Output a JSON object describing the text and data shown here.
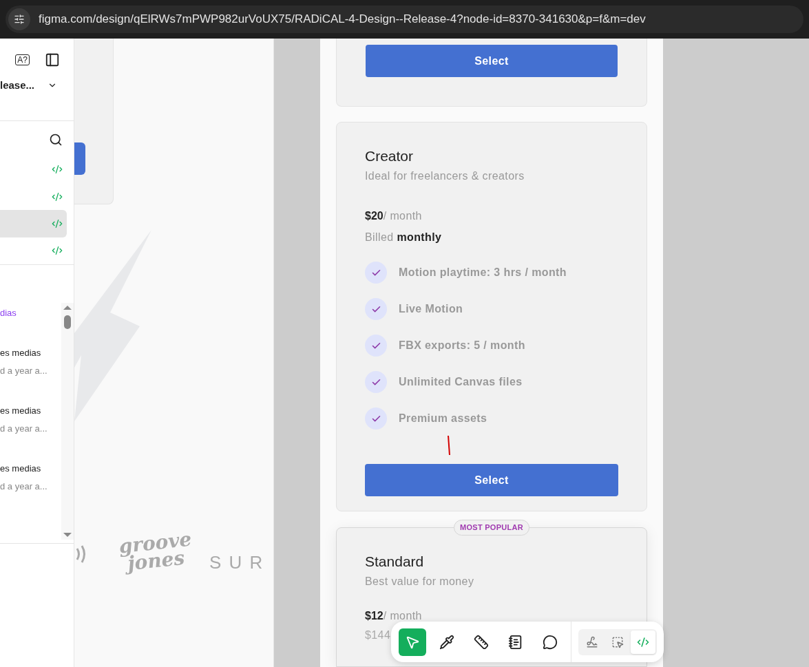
{
  "address_bar": {
    "url": "figma.com/design/qElRWs7mPWP982urVoUX75/RADiCAL-4-Design--Release-4?node-id=8370-341630&p=f&m=dev"
  },
  "sidebar": {
    "header_badge": "A?",
    "file_name": "lease...",
    "layers": [
      {
        "selected": false
      },
      {
        "selected": false
      },
      {
        "selected": true
      },
      {
        "selected": false
      }
    ],
    "comments_heading": "dias",
    "comments": [
      {
        "title": "es medias",
        "meta": "d a year a..."
      },
      {
        "title": "es medias",
        "meta": "d a year a..."
      },
      {
        "title": "es medias",
        "meta": "d a year a..."
      }
    ]
  },
  "canvas": {
    "logos": [
      "groove",
      "jones",
      "S U R"
    ]
  },
  "plans": [
    {
      "button": "Select"
    },
    {
      "name": "Creator",
      "subtitle": "Ideal for freelancers & creators",
      "price": "$20",
      "period": "/ month",
      "billing": "Billed **monthly**",
      "features": [
        "Motion playtime: 3 hrs / month",
        "Live Motion",
        "FBX exports: 5 / month",
        "Unlimited Canvas files",
        "Premium assets"
      ],
      "button": "Select"
    },
    {
      "badge": "MOST POPULAR",
      "name": "Standard",
      "subtitle": "Best value for money",
      "price": "$12",
      "period": "/ month",
      "billing": "$144"
    }
  ],
  "toolbar": {
    "tools": [
      {
        "kind": "pointer",
        "selected": true
      },
      {
        "kind": "dropper",
        "selected": false
      },
      {
        "kind": "ruler",
        "selected": false
      },
      {
        "kind": "annotate",
        "selected": false
      },
      {
        "kind": "comment",
        "selected": false
      }
    ],
    "modes": [
      {
        "kind": "draw",
        "selected": false
      },
      {
        "kind": "layout",
        "selected": false
      },
      {
        "kind": "code",
        "selected": true
      }
    ]
  }
}
